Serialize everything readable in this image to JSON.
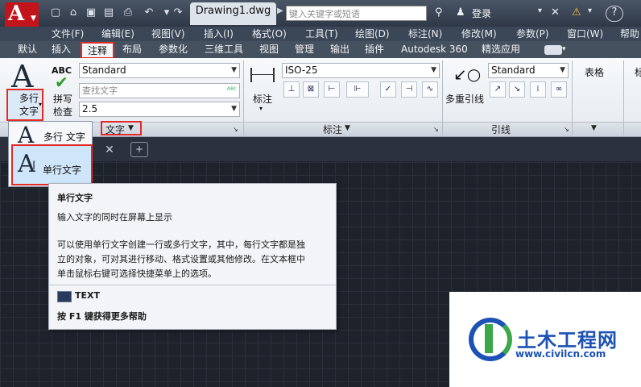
{
  "title_bar": {
    "document_tab": "Drawing1.dwg",
    "search_placeholder": "键入关键字或短语",
    "login_label": "登录"
  },
  "menu_bar": [
    "文件(F)",
    "编辑(E)",
    "视图(V)",
    "插入(I)",
    "格式(O)",
    "工具(T)",
    "绘图(D)",
    "标注(N)",
    "修改(M)",
    "参数(P)",
    "窗口(W)",
    "帮助"
  ],
  "ribbon_tabs": [
    "默认",
    "插入",
    "注释",
    "布局",
    "参数化",
    "三维工具",
    "视图",
    "管理",
    "输出",
    "插件",
    "Autodesk 360",
    "精选应用"
  ],
  "active_tab": "注释",
  "text_panel": {
    "multiline_text_label_1": "多行",
    "multiline_text_label_2": "文字",
    "abc_label": "ABC",
    "spell_check_1": "拼写",
    "spell_check_2": "检查",
    "text_style": "Standard",
    "find_text_placeholder": "查找文字",
    "text_height": "2.5",
    "panel_title": "文字"
  },
  "dimension_panel": {
    "dim_label": "标注",
    "dim_style": "ISO-25",
    "panel_title": "标注"
  },
  "leader_panel": {
    "multileader_label": "多重引线",
    "leader_style": "Standard",
    "panel_title": "引线"
  },
  "table_panel": {
    "label": "表格"
  },
  "dropdown": {
    "item1": "多行 文字",
    "item2": "单行文字"
  },
  "tooltip": {
    "title": "单行文字",
    "summary": "输入文字的同时在屏幕上显示",
    "body_line1": "可以使用单行文字创建一行或多行文字，其中，每行文字都是独",
    "body_line2": "立的对象，可对其进行移动、格式设置或其他修改。在文本框中",
    "body_line3": "单击鼠标右键可选择快捷菜单上的选项。",
    "command": "TEXT",
    "help": "按 F1 键获得更多帮助"
  },
  "watermark": {
    "name": "土木工程网",
    "url": "www.civilcn.com"
  },
  "colors": {
    "highlight": "#e12b2b",
    "canvas": "#1e222b",
    "watermark_blue": "#1c52b5",
    "watermark_green": "#3aa84a"
  }
}
